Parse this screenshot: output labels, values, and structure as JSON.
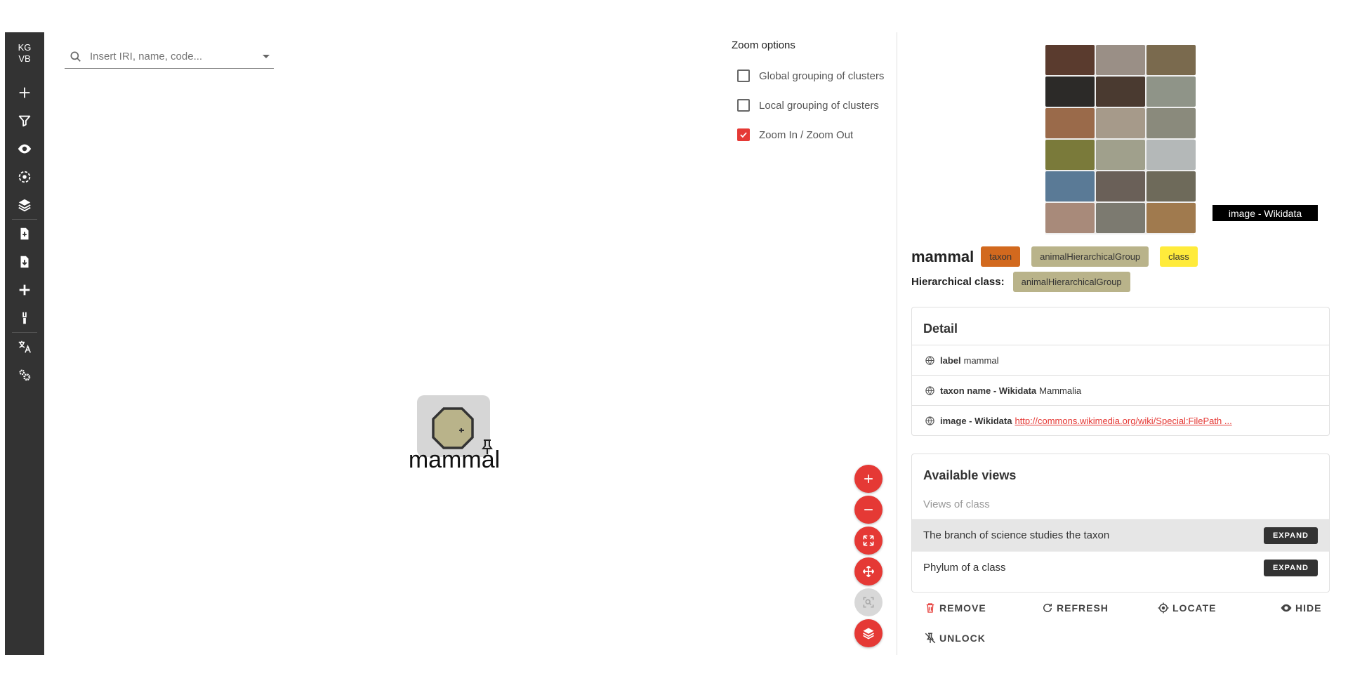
{
  "sidebar": {
    "brand": "KG\nVB",
    "items": [
      {
        "name": "add-icon"
      },
      {
        "name": "filter-icon"
      },
      {
        "name": "eye-icon"
      },
      {
        "name": "focus-icon"
      },
      {
        "name": "layers-icon"
      },
      {
        "name": "import-file-icon"
      },
      {
        "name": "export-file-icon"
      },
      {
        "name": "add-alt-icon"
      },
      {
        "name": "brush-icon"
      },
      {
        "name": "translate-icon"
      },
      {
        "name": "settings-icon"
      }
    ]
  },
  "search": {
    "placeholder": "Insert IRI, name, code..."
  },
  "zoom_options": {
    "title": "Zoom options",
    "items": [
      {
        "label": "Global grouping of clusters",
        "checked": false
      },
      {
        "label": "Local grouping of clusters",
        "checked": false
      },
      {
        "label": "Zoom In / Zoom Out",
        "checked": true
      }
    ]
  },
  "graph": {
    "node_label": "mammal"
  },
  "colors": {
    "accent": "#e53935",
    "sidebar": "#333333",
    "taxon_chip": "#d2691e",
    "group_chip": "#b9b38a",
    "class_chip": "#ffeb3b"
  },
  "panel": {
    "image_caption": "image - Wikidata",
    "title": "mammal",
    "chips": [
      {
        "label": "taxon",
        "color": "#d2691e"
      },
      {
        "label": "animalHierarchicalGroup",
        "color": "#b9b38a"
      },
      {
        "label": "class",
        "color": "#ffeb3b"
      }
    ],
    "hierarchical_label": "Hierarchical class:",
    "hierarchical_value": "animalHierarchicalGroup",
    "detail": {
      "title": "Detail",
      "rows": [
        {
          "key": "label",
          "value": "mammal"
        },
        {
          "key": "taxon name - Wikidata",
          "value": "Mammalia"
        },
        {
          "key": "image - Wikidata",
          "value": "http://commons.wikimedia.org/wiki/Special:FilePath ..."
        }
      ]
    },
    "views": {
      "title": "Available views",
      "subtitle": "Views of class",
      "items": [
        {
          "label": "The branch of science studies the taxon",
          "button": "EXPAND"
        },
        {
          "label": "Phylum of a class",
          "button": "EXPAND"
        }
      ]
    },
    "actions": {
      "remove": "REMOVE",
      "refresh": "REFRESH",
      "locate": "LOCATE",
      "hide": "HIDE",
      "unlock": "UNLOCK"
    }
  }
}
